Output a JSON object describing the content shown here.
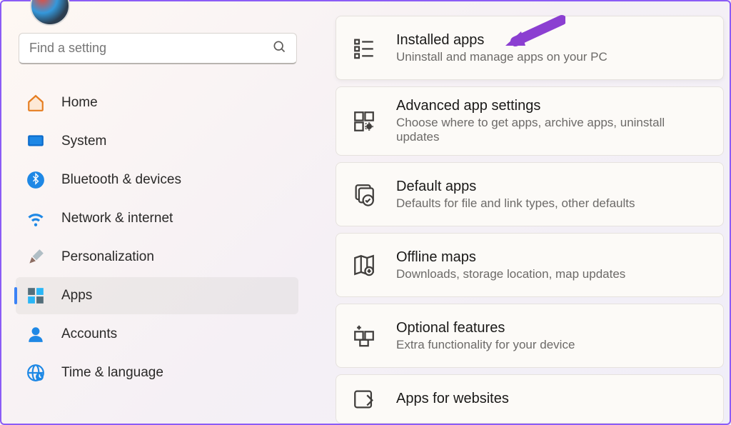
{
  "search": {
    "placeholder": "Find a setting"
  },
  "nav": {
    "items": [
      {
        "label": "Home"
      },
      {
        "label": "System"
      },
      {
        "label": "Bluetooth & devices"
      },
      {
        "label": "Network & internet"
      },
      {
        "label": "Personalization"
      },
      {
        "label": "Apps"
      },
      {
        "label": "Accounts"
      },
      {
        "label": "Time & language"
      }
    ]
  },
  "cards": {
    "items": [
      {
        "title": "Installed apps",
        "sub": "Uninstall and manage apps on your PC"
      },
      {
        "title": "Advanced app settings",
        "sub": "Choose where to get apps, archive apps, uninstall updates"
      },
      {
        "title": "Default apps",
        "sub": "Defaults for file and link types, other defaults"
      },
      {
        "title": "Offline maps",
        "sub": "Downloads, storage location, map updates"
      },
      {
        "title": "Optional features",
        "sub": "Extra functionality for your device"
      },
      {
        "title": "Apps for websites",
        "sub": ""
      }
    ]
  }
}
